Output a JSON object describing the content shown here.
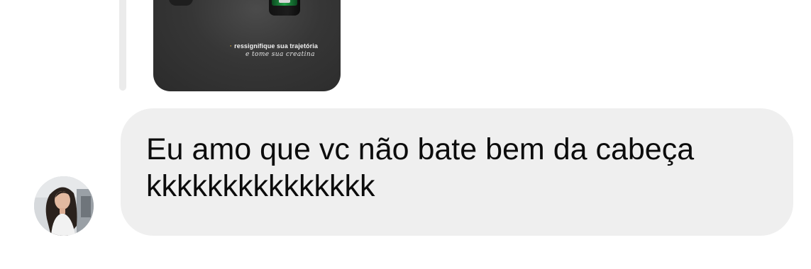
{
  "story": {
    "caption_line1": "ressignifique sua trajetória",
    "caption_line2": "e tome sua creatina"
  },
  "message": {
    "text": "Eu amo que vc não bate bem da cabeça\nkkkkkkkkkkkkkkk"
  },
  "colors": {
    "bubble_bg": "#efefef",
    "text": "#0c0c0c",
    "reply_bar": "#ebebeb"
  }
}
